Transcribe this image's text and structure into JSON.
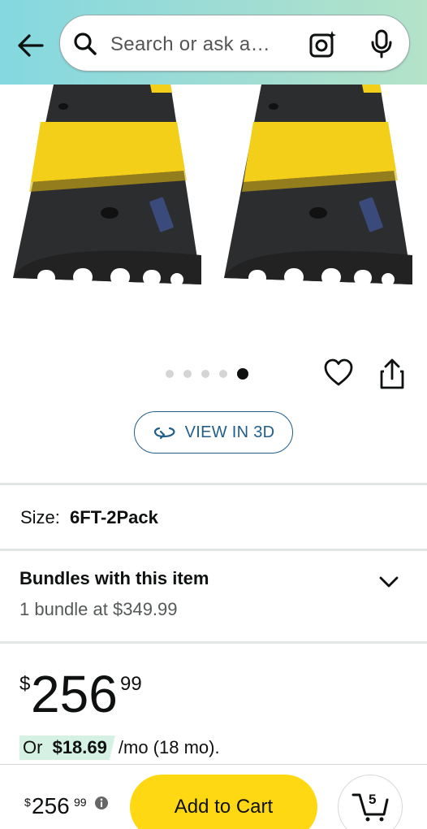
{
  "header": {
    "search_placeholder": "Search or ask a…",
    "gradient_colors": [
      "#84d8e0",
      "#b4e3c8"
    ]
  },
  "product_image": {
    "alt": "Black and yellow rubber speed bump, two units",
    "colors": {
      "rubber": "#2b2d2f",
      "stripe": "#f4cf1a"
    },
    "carousel_dot_count": 5,
    "carousel_active_index": 4
  },
  "view_3d_label": "VIEW IN 3D",
  "size": {
    "label": "Size:",
    "value": "6FT-2Pack"
  },
  "bundles": {
    "title": "Bundles with this item",
    "subtitle": "1 bundle at $349.99"
  },
  "price": {
    "symbol": "$",
    "whole": "256",
    "fraction": "99"
  },
  "monthly": {
    "or": "Or",
    "amount": "$18.69",
    "suffix": "/mo (18 mo)."
  },
  "bottom_bar": {
    "price_symbol": "$",
    "price_whole": "256",
    "price_fraction": "99",
    "add_to_cart": "Add to Cart",
    "cart_count": "5"
  },
  "colors": {
    "accent_link": "#1f5e8a",
    "add_to_cart_bg": "#ffd814",
    "monthly_badge_bg": "#d4f1e3"
  }
}
